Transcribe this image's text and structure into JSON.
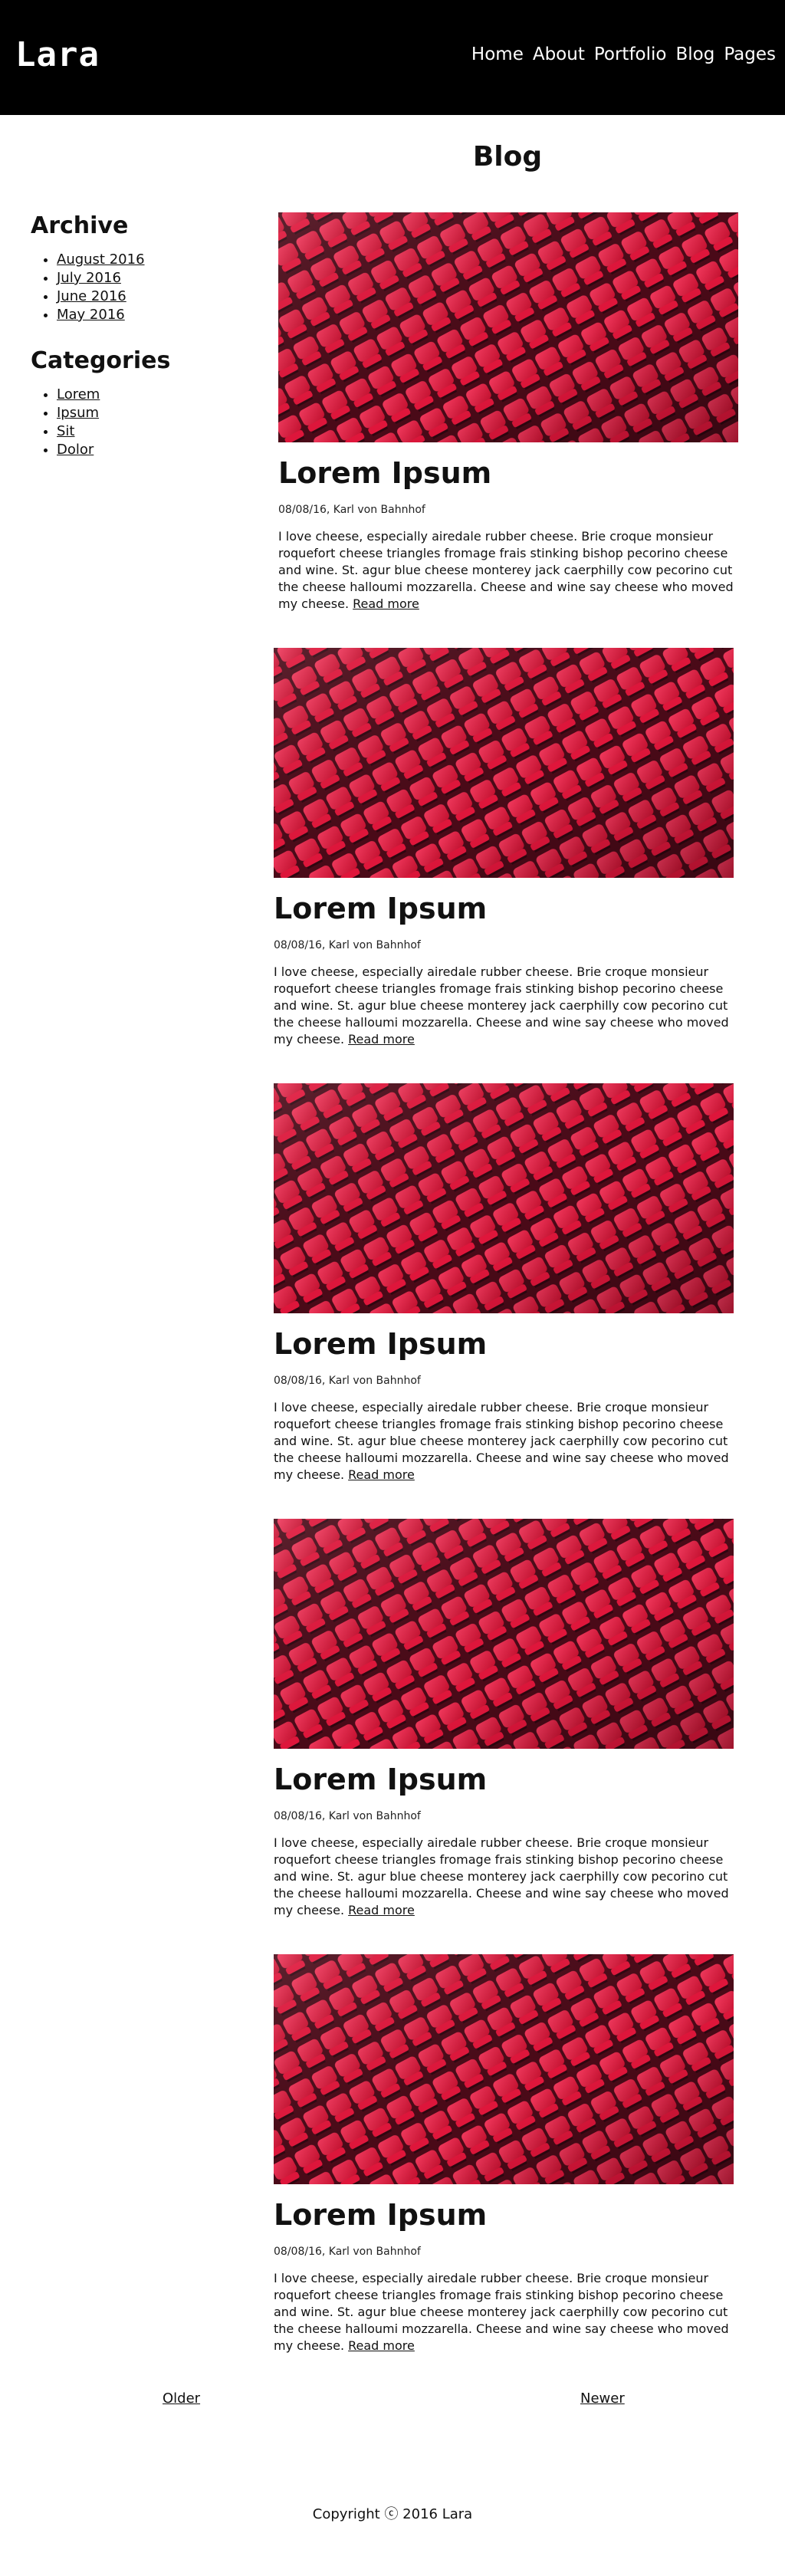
{
  "header": {
    "logo": "Lara",
    "nav": [
      "Home",
      "About",
      "Portfolio",
      "Blog",
      "Pages"
    ]
  },
  "page_title": "Blog",
  "sidebar": {
    "archive_title": "Archive",
    "archive_items": [
      "August 2016",
      "July 2016",
      "June 2016",
      "May 2016"
    ],
    "categories_title": "Categories",
    "category_items": [
      "Lorem",
      "Ipsum",
      "Sit",
      "Dolor"
    ]
  },
  "posts": [
    {
      "title": "Lorem Ipsum",
      "meta": "08/08/16, Karl von Bahnhof",
      "excerpt": "I love cheese, especially airedale rubber cheese. Brie croque monsieur roquefort cheese triangles fromage frais stinking bishop pecorino cheese and wine. St. agur blue cheese monterey jack caerphilly cow pecorino cut the cheese halloumi mozzarella. Cheese and wine say cheese who moved my cheese.",
      "read_more": "Read more"
    },
    {
      "title": "Lorem Ipsum",
      "meta": "08/08/16, Karl von Bahnhof",
      "excerpt": "I love cheese, especially airedale rubber cheese. Brie croque monsieur roquefort cheese triangles fromage frais stinking bishop pecorino cheese and wine. St. agur blue cheese monterey jack caerphilly cow pecorino cut the cheese halloumi mozzarella. Cheese and wine say cheese who moved my cheese.",
      "read_more": "Read more"
    },
    {
      "title": "Lorem Ipsum",
      "meta": "08/08/16, Karl von Bahnhof",
      "excerpt": "I love cheese, especially airedale rubber cheese. Brie croque monsieur roquefort cheese triangles fromage frais stinking bishop pecorino cheese and wine. St. agur blue cheese monterey jack caerphilly cow pecorino cut the cheese halloumi mozzarella. Cheese and wine say cheese who moved my cheese.",
      "read_more": "Read more"
    },
    {
      "title": "Lorem Ipsum",
      "meta": "08/08/16, Karl von Bahnhof",
      "excerpt": "I love cheese, especially airedale rubber cheese. Brie croque monsieur roquefort cheese triangles fromage frais stinking bishop pecorino cheese and wine. St. agur blue cheese monterey jack caerphilly cow pecorino cut the cheese halloumi mozzarella. Cheese and wine say cheese who moved my cheese.",
      "read_more": "Read more"
    },
    {
      "title": "Lorem Ipsum",
      "meta": "08/08/16, Karl von Bahnhof",
      "excerpt": "I love cheese, especially airedale rubber cheese. Brie croque monsieur roquefort cheese triangles fromage frais stinking bishop pecorino cheese and wine. St. agur blue cheese monterey jack caerphilly cow pecorino cut the cheese halloumi mozzarella. Cheese and wine say cheese who moved my cheese.",
      "read_more": "Read more"
    }
  ],
  "pagination": {
    "older": "Older",
    "newer": "Newer"
  },
  "footer": {
    "copyright": "Copyright ⓒ 2016 Lara"
  },
  "colors": {
    "header_bg": "#000000",
    "seat_red": "#e8173f",
    "seat_dark": "#5a0d1c"
  }
}
